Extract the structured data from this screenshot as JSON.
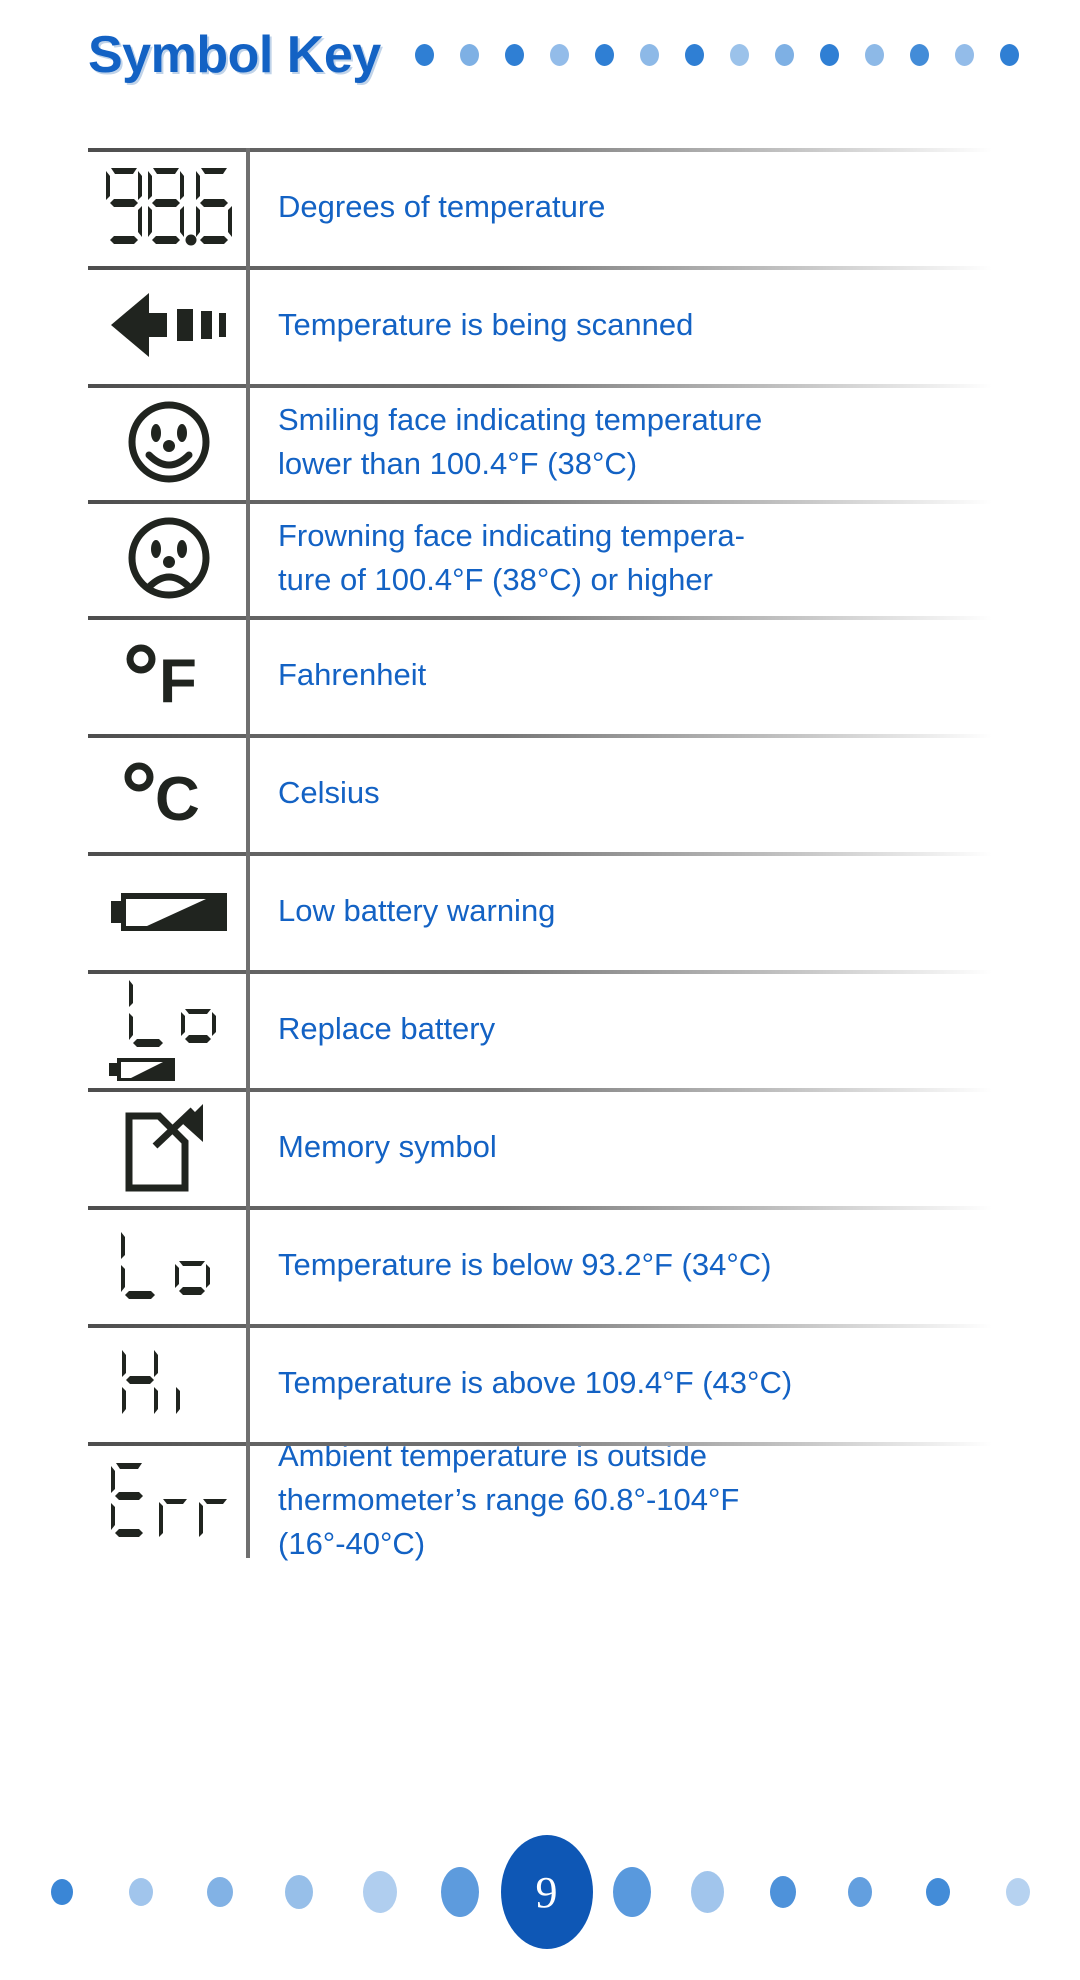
{
  "header": {
    "title": "Symbol Key",
    "dot_count": 14,
    "dot_opacities": [
      1.0,
      0.62,
      1.0,
      0.52,
      1.0,
      0.55,
      1.0,
      0.48,
      0.62,
      1.0,
      0.55,
      0.9,
      0.52,
      1.0
    ],
    "accent_color": "#1362c4"
  },
  "table": {
    "rows": [
      {
        "symbol": "lcd-986",
        "symbol_text": "98.6",
        "description": "Degrees of temperature"
      },
      {
        "symbol": "scan-arrow-icon",
        "symbol_text": "",
        "description": "Temperature is being scanned"
      },
      {
        "symbol": "smiling-face-icon",
        "symbol_text": "",
        "description": "Smiling face indicating temperature lower than 100.4°F (38°C)"
      },
      {
        "symbol": "frowning-face-icon",
        "symbol_text": "",
        "description": "Frowning face indicating tempera-ture of 100.4°F (38°C) or higher"
      },
      {
        "symbol": "degrees-fahrenheit-icon",
        "symbol_text": "°F",
        "description": "Fahrenheit"
      },
      {
        "symbol": "degrees-celsius-icon",
        "symbol_text": "°C",
        "description": "Celsius"
      },
      {
        "symbol": "low-battery-icon",
        "symbol_text": "",
        "description": "Low battery warning"
      },
      {
        "symbol": "lcd-lo-battery-icon",
        "symbol_text": "Lo",
        "description": "Replace battery"
      },
      {
        "symbol": "memory-symbol-icon",
        "symbol_text": "",
        "description": "Memory symbol"
      },
      {
        "symbol": "lcd-lo",
        "symbol_text": "Lo",
        "description": "Temperature is below 93.2°F (34°C)"
      },
      {
        "symbol": "lcd-hi",
        "symbol_text": "Hi",
        "description": "Temperature is above 109.4°F (43°C)"
      },
      {
        "symbol": "lcd-err",
        "symbol_text": "Err",
        "description": "Ambient temperature is outside thermometer’s range 60.8°-104°F (16°-40°C)"
      }
    ],
    "row_descriptions_lines": {
      "0": [
        "Degrees of temperature"
      ],
      "1": [
        "Temperature is being scanned"
      ],
      "2": [
        "Smiling face indicating temperature",
        "lower than 100.4°F (38°C)"
      ],
      "3": [
        "Frowning face indicating tempera-",
        "ture of 100.4°F (38°C) or higher"
      ],
      "4": [
        "Fahrenheit"
      ],
      "5": [
        "Celsius"
      ],
      "6": [
        "Low battery warning"
      ],
      "7": [
        "Replace battery"
      ],
      "8": [
        "Memory symbol"
      ],
      "9": [
        "Temperature is below 93.2°F (34°C)"
      ],
      "10": [
        "Temperature is above 109.4°F (43°C)"
      ],
      "11": [
        "Ambient temperature is outside",
        "thermometer’s range 60.8°-104°F",
        "(16°-40°C)"
      ]
    }
  },
  "footer": {
    "page_number": "9",
    "left_dot_opacities": [
      0.95,
      0.45,
      0.6,
      0.5,
      0.38,
      0.78
    ],
    "right_dot_opacities": [
      0.8,
      0.45,
      0.85,
      0.75,
      0.9,
      0.35
    ],
    "badge_color": "#0e57b5"
  }
}
